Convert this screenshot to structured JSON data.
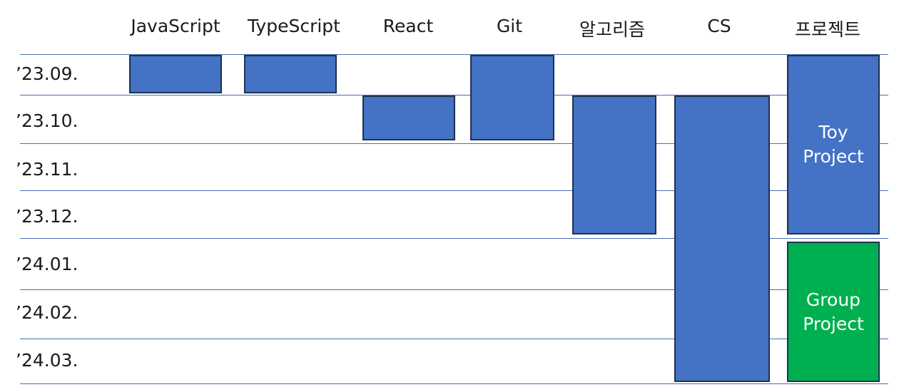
{
  "columns": [
    {
      "key": "javascript",
      "label": "JavaScript"
    },
    {
      "key": "typescript",
      "label": "TypeScript"
    },
    {
      "key": "react",
      "label": "React"
    },
    {
      "key": "git",
      "label": "Git"
    },
    {
      "key": "algorithm",
      "label": "알고리즘"
    },
    {
      "key": "cs",
      "label": "CS"
    },
    {
      "key": "project",
      "label": "프로젝트"
    }
  ],
  "rows": [
    "’23.09.",
    "’23.10.",
    "’23.11.",
    "’23.12.",
    "’24.01.",
    "’24.02.",
    "’24.03."
  ],
  "colors": {
    "study": "#4472c4",
    "group_project": "#00b050",
    "gridline": "#4a6fb5",
    "bar_border": "#1f3150"
  },
  "bars": [
    {
      "column": "javascript",
      "start": "’23.09.",
      "end": "’23.09.",
      "color": "#4472c4"
    },
    {
      "column": "typescript",
      "start": "’23.09.",
      "end": "’23.09.",
      "color": "#4472c4"
    },
    {
      "column": "react",
      "start": "’23.10.",
      "end": "’23.10.",
      "color": "#4472c4"
    },
    {
      "column": "git",
      "start": "’23.09.",
      "end": "’23.10.",
      "color": "#4472c4"
    },
    {
      "column": "algorithm",
      "start": "’23.10.",
      "end": "’23.12.",
      "color": "#4472c4"
    },
    {
      "column": "cs",
      "start": "’23.10.",
      "end": "’24.03.",
      "color": "#4472c4"
    },
    {
      "column": "project",
      "start": "’23.09.",
      "end": "’23.12.",
      "color": "#4472c4",
      "label": [
        "Toy",
        "Project"
      ]
    },
    {
      "column": "project",
      "start": "’24.01.",
      "end": "’24.03.",
      "color": "#00b050",
      "label": [
        "Group",
        "Project"
      ]
    }
  ]
}
